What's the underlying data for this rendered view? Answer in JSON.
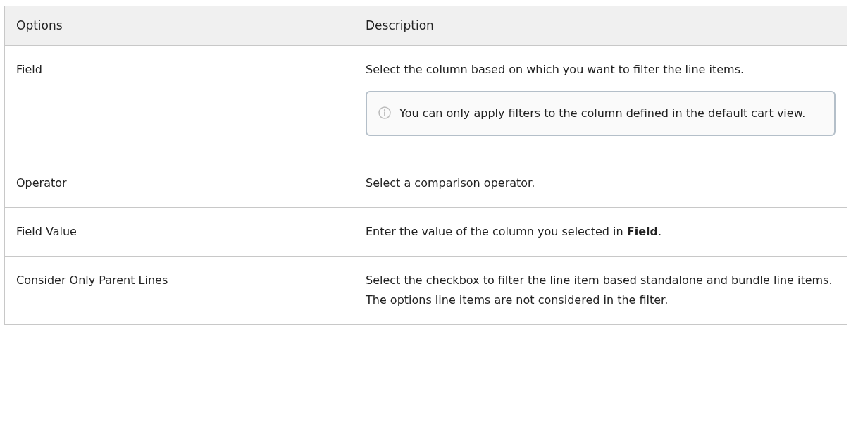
{
  "table": {
    "columns": [
      "Options",
      "Description"
    ],
    "rows": [
      {
        "option": "Field",
        "description": "Select the column based on which you want to filter the line items.",
        "note": "You can only apply filters to the column defined in the default cart view."
      },
      {
        "option": "Operator",
        "description": "Select a comparison operator."
      },
      {
        "option": "Field Value",
        "description": "Enter the value of the column you selected in **Field**."
      },
      {
        "option": "Consider Only Parent Lines",
        "description": "Select the checkbox to filter the line item based standalone and bundle line items. The options line items are not considered in the filter."
      }
    ]
  }
}
